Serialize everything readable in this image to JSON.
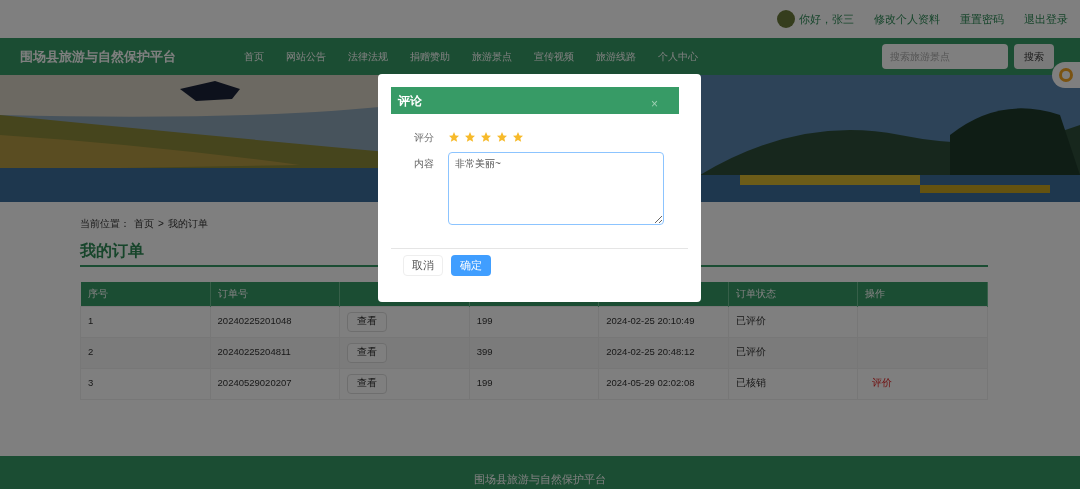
{
  "user_bar": {
    "greeting": "你好，张三",
    "links": [
      "修改个人资料",
      "重置密码",
      "退出登录"
    ]
  },
  "nav": {
    "site_title": "围场县旅游与自然保护平台",
    "items": [
      "首页",
      "网站公告",
      "法律法规",
      "捐赠赞助",
      "旅游景点",
      "宣传视频",
      "旅游线路",
      "个人中心"
    ],
    "search": {
      "placeholder": "搜索旅游景点",
      "button": "搜索"
    }
  },
  "breadcrumb": {
    "label": "当前位置：",
    "path": [
      "首页",
      "我的订单"
    ],
    "separator": ">"
  },
  "page_title": "我的订单",
  "table": {
    "columns": [
      "序号",
      "订单号",
      "",
      "",
      "",
      "订单状态",
      "操作"
    ],
    "rows": [
      {
        "cells": [
          "1",
          "20240225201048",
          "查看",
          "199",
          "2024-02-25 20:10:49",
          "已评价",
          ""
        ]
      },
      {
        "cells": [
          "2",
          "20240225204811",
          "查看",
          "399",
          "2024-02-25 20:48:12",
          "已评价",
          ""
        ]
      },
      {
        "cells": [
          "3",
          "20240529020207",
          "查看",
          "199",
          "2024-05-29 02:02:08",
          "已核销",
          "评价"
        ]
      }
    ]
  },
  "footer": {
    "text": "围场县旅游与自然保护平台"
  },
  "dialog": {
    "title": "评论",
    "close": "×",
    "rating_label": "评分",
    "stars": 5,
    "content_label": "内容",
    "content_value": "非常美丽~",
    "buttons": [
      {
        "label": "取消",
        "kind": "default"
      },
      {
        "label": "确定",
        "kind": "primary"
      }
    ]
  }
}
